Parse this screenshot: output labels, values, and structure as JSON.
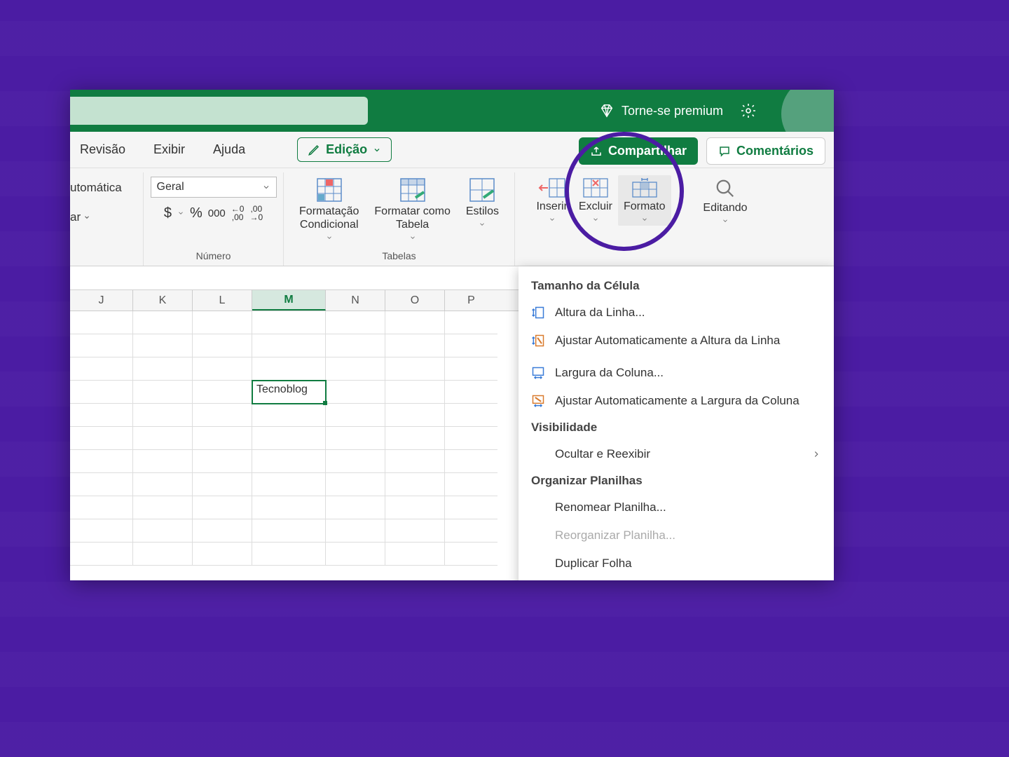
{
  "titlebar": {
    "premium": "Torne-se premium"
  },
  "tabs": {
    "revisao": "Revisão",
    "exibir": "Exibir",
    "ajuda": "Ajuda",
    "editing": "Edição",
    "share": "Compartilhar",
    "comments": "Comentários"
  },
  "ribbon": {
    "frag_top": "utomática",
    "frag_bottom": "ar",
    "number": {
      "select": "Geral",
      "label": "Número",
      "dollar": "$",
      "percent": "%",
      "thousand": "000",
      "dec_inc": "←0\n,00",
      "dec_dec": ",00\n→0"
    },
    "tables": {
      "cond_fmt": "Formatação\nCondicional",
      "fmt_table": "Formatar como\nTabela",
      "styles": "Estilos",
      "label": "Tabelas"
    },
    "cells": {
      "insert": "Inserir",
      "delete": "Excluir",
      "format": "Formato"
    },
    "editing": {
      "label": "Editando"
    }
  },
  "columns": [
    "J",
    "K",
    "L",
    "M",
    "N",
    "O",
    "P"
  ],
  "active_column_index": 3,
  "cell_value": "Tecnoblog",
  "dropdown": {
    "header_size": "Tamanho da Célula",
    "row_height": "Altura da Linha...",
    "autofit_row": "Ajustar Automaticamente a Altura da Linha",
    "col_width": "Largura da Coluna...",
    "autofit_col": "Ajustar Automaticamente a Largura da Coluna",
    "header_vis": "Visibilidade",
    "hide_unhide": "Ocultar e Reexibir",
    "header_org": "Organizar Planilhas",
    "rename": "Renomear Planilha...",
    "reorg": "Reorganizar Planilha...",
    "duplicate": "Duplicar Folha"
  }
}
